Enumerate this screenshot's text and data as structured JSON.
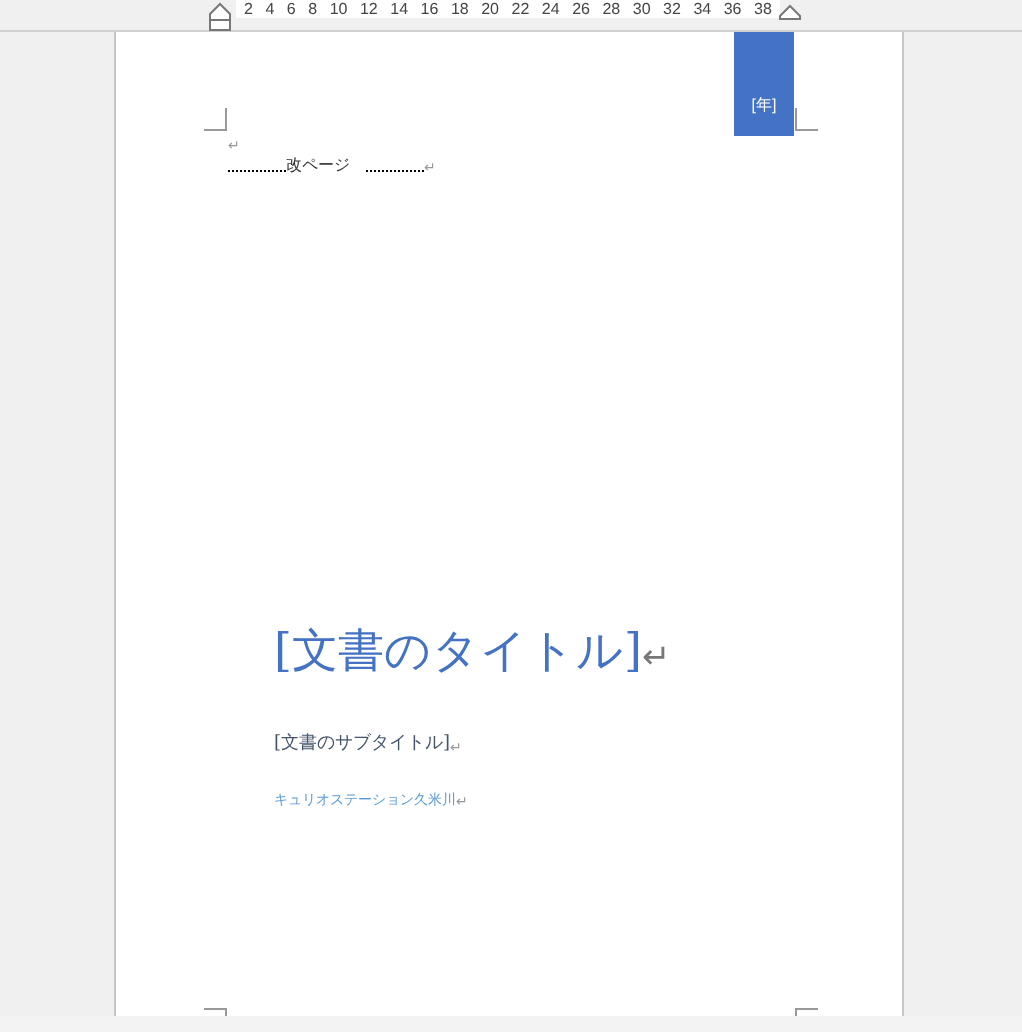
{
  "ruler": {
    "ticks": [
      "2",
      "4",
      "6",
      "8",
      "10",
      "12",
      "14",
      "16",
      "18",
      "20",
      "22",
      "24",
      "26",
      "28",
      "30",
      "32",
      "34",
      "36",
      "38"
    ]
  },
  "header": {
    "year_placeholder": "[年]",
    "mark": "↵"
  },
  "page_break": {
    "label": "改ページ",
    "mark": "↵"
  },
  "cover": {
    "title": "[文書のタイトル]",
    "title_mark": "↵",
    "subtitle": "[文書のサブタイトル]",
    "subtitle_mark": "↵",
    "author": "キュリオステーション久米川",
    "author_mark": "↵"
  }
}
